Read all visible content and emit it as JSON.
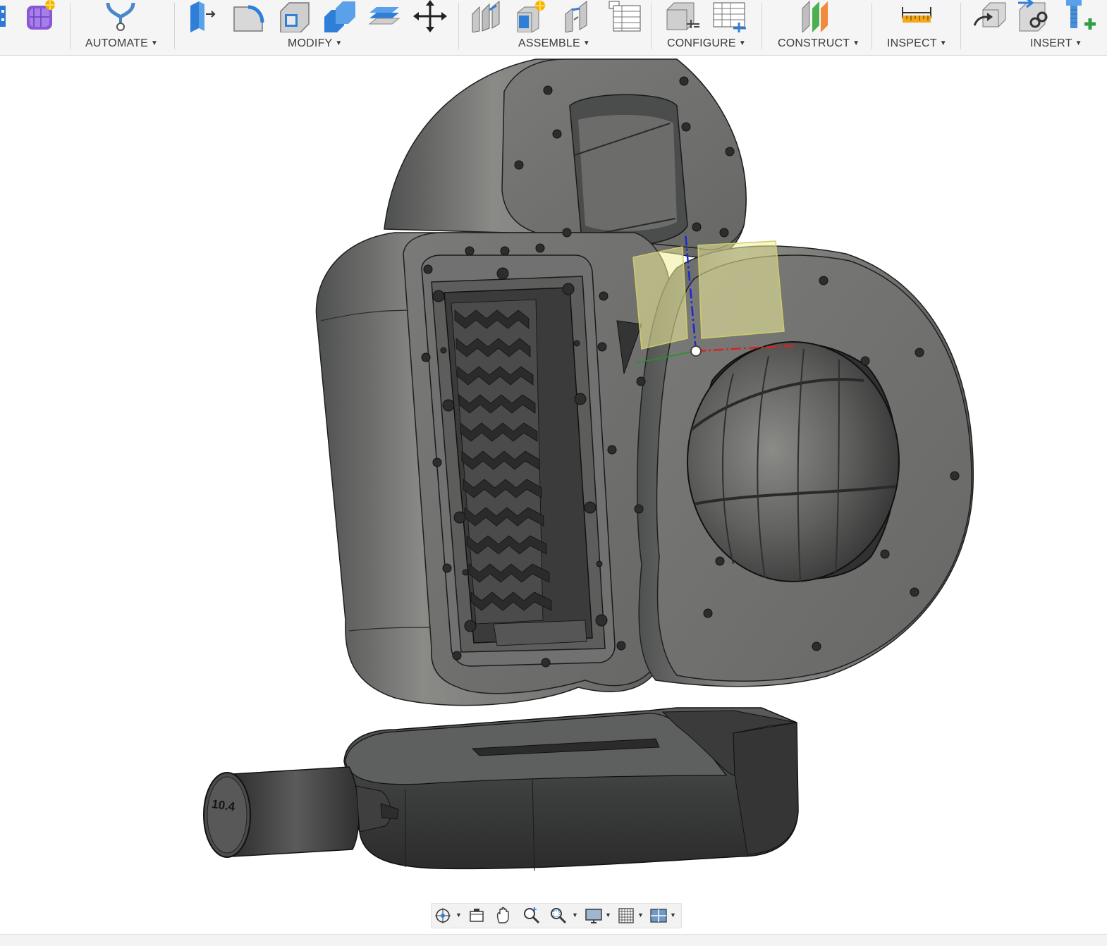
{
  "toolbar": {
    "groups": {
      "automate": {
        "label": "AUTOMATE"
      },
      "modify": {
        "label": "MODIFY"
      },
      "assemble": {
        "label": "ASSEMBLE"
      },
      "configure": {
        "label": "CONFIGURE"
      },
      "construct": {
        "label": "CONSTRUCT"
      },
      "inspect": {
        "label": "INSPECT"
      },
      "insert": {
        "label": "INSERT"
      }
    },
    "caret": "▼"
  },
  "model": {
    "label_text": "10.4"
  },
  "navbar": {
    "caret": "▼"
  },
  "colors": {
    "ribbon_bg": "#f5f5f5",
    "model_gray": "#6f6f6e",
    "model_dark": "#3f4140",
    "axis_x": "#e02020",
    "axis_y": "#1a9a1a",
    "axis_z": "#1a2ad0",
    "plane_yellow": "#f0ee9a"
  }
}
